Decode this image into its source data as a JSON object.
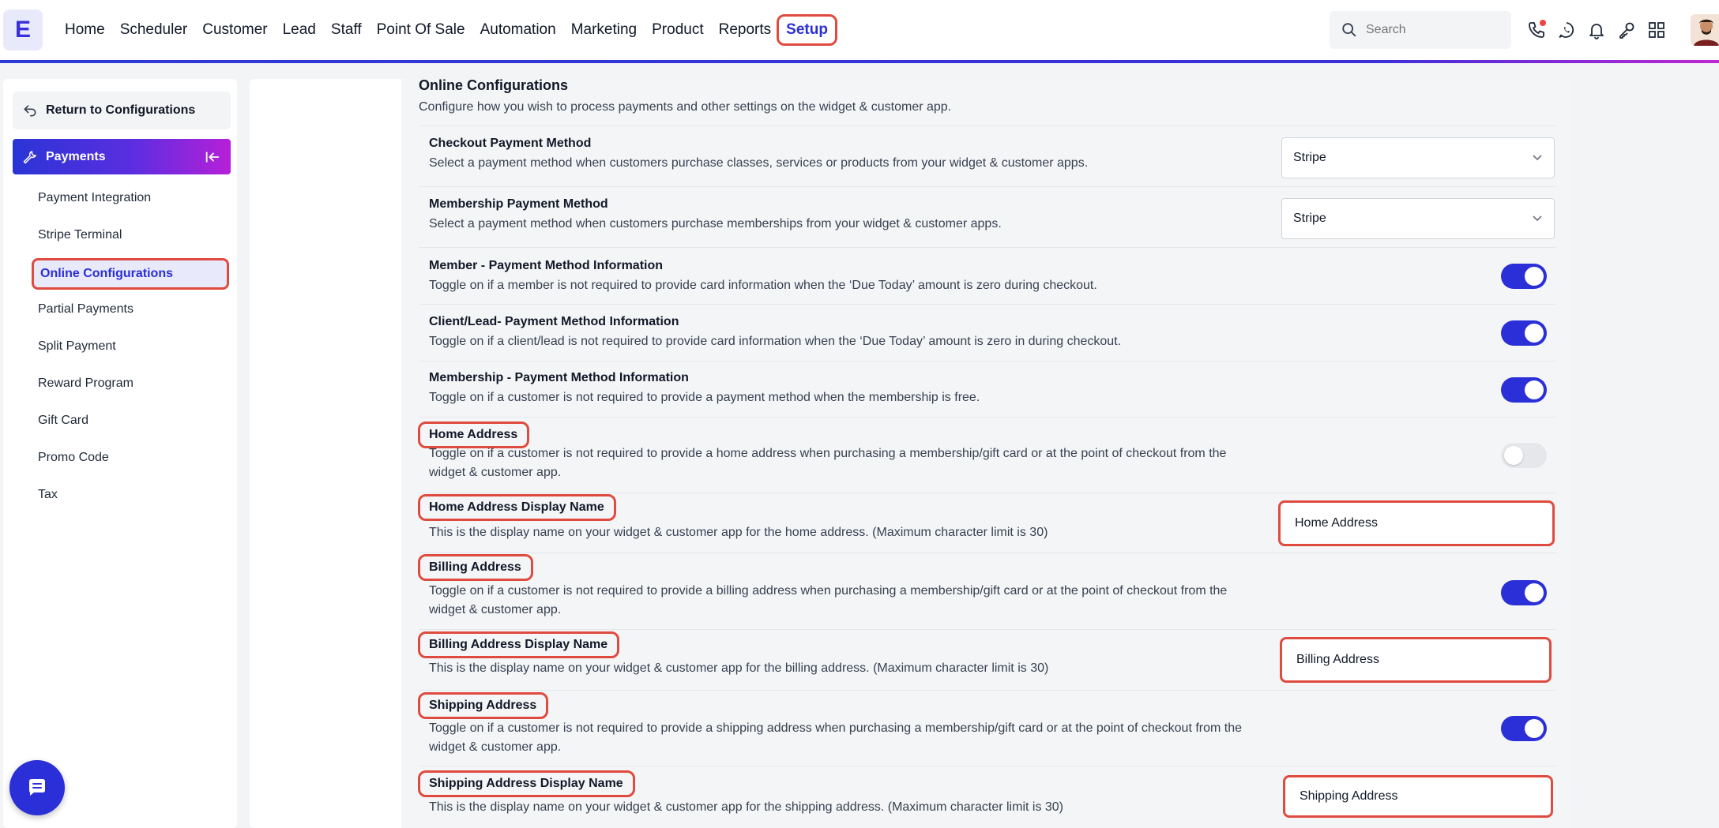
{
  "app": {
    "logo_letter": "E"
  },
  "nav": {
    "items": [
      "Home",
      "Scheduler",
      "Customer",
      "Lead",
      "Staff",
      "Point Of Sale",
      "Automation",
      "Marketing",
      "Product",
      "Reports"
    ],
    "active": "Setup"
  },
  "search": {
    "placeholder": "Search"
  },
  "top_icons": [
    "phone-icon",
    "whatsapp-icon",
    "bell-icon",
    "key-icon",
    "apps-grid-icon"
  ],
  "sidebar": {
    "return_label": "Return to Configurations",
    "section_label": "Payments",
    "items": [
      "Payment Integration",
      "Stripe Terminal",
      "Online Configurations",
      "Partial Payments",
      "Split Payment",
      "Reward Program",
      "Gift Card",
      "Promo Code",
      "Tax"
    ],
    "active_index": 2
  },
  "panel": {
    "title": "Online Configurations",
    "subtitle": "Configure how you wish to process payments and other settings on the widget & customer app."
  },
  "settings": [
    {
      "title": "Checkout Payment Method",
      "desc": "Select a payment method when customers purchase classes, services or products from your widget & customer apps.",
      "control": "select",
      "value": "Stripe"
    },
    {
      "title": "Membership Payment Method",
      "desc": "Select a payment method when customers purchase memberships from your widget & customer apps.",
      "control": "select",
      "value": "Stripe"
    },
    {
      "title": "Member - Payment Method Information",
      "desc": "Toggle on if a member is not required to provide card information when the ‘Due Today’ amount is zero during checkout.",
      "control": "toggle",
      "on": true
    },
    {
      "title": "Client/Lead- Payment Method Information",
      "desc": "Toggle on if a client/lead is not required to provide card information when the ‘Due Today’ amount is zero in during checkout.",
      "control": "toggle",
      "on": true
    },
    {
      "title": "Membership - Payment Method Information",
      "desc": "Toggle on if a customer is not required to provide a payment method when the membership is free.",
      "control": "toggle",
      "on": true
    },
    {
      "title": "Home Address",
      "desc1": "Toggle on if a customer is not required to provide a home address when purchasing a membership/gift card or at the point of checkout from the",
      "desc2": "widget & customer app.",
      "control": "toggle",
      "on": false
    },
    {
      "title": "Home Address Display Name",
      "desc": "This is the display name on your widget & customer app for the home address. (Maximum character limit is 30)",
      "control": "text",
      "value": "Home Address"
    },
    {
      "title": "Billing Address",
      "desc1": "Toggle on if a customer is not required to provide a billing address when purchasing a membership/gift card or at the point of checkout from the",
      "desc2": "widget & customer app.",
      "control": "toggle",
      "on": true
    },
    {
      "title": "Billing Address Display Name",
      "desc": "This is the display name on your widget & customer app for the billing address. (Maximum character limit is 30)",
      "control": "text",
      "value": "Billing Address"
    },
    {
      "title": "Shipping Address",
      "desc1": "Toggle on if a customer is not required to provide a shipping address when purchasing a membership/gift card or at the point of checkout from the",
      "desc2": "widget & customer app.",
      "control": "toggle",
      "on": true
    },
    {
      "title": "Shipping Address Display Name",
      "desc": "This is the display name on your widget & customer app for the shipping address. (Maximum character limit is 30)",
      "control": "text",
      "value": "Shipping Address"
    }
  ],
  "colors": {
    "accent": "#2b2fd8",
    "highlight": "#e04b3f",
    "active_bg": "#e8e9fb"
  }
}
